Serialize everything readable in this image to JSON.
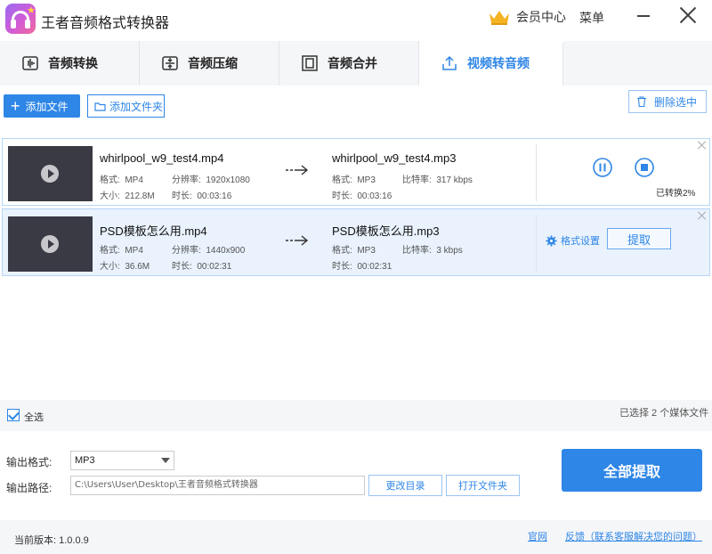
{
  "app": {
    "title": "王者音频格式转换器",
    "vip_label": "会员中心",
    "menu_label": "菜单"
  },
  "tabs": [
    {
      "label": "音频转换",
      "icon": "audio-wave-icon",
      "active": false
    },
    {
      "label": "音频压缩",
      "icon": "compress-icon",
      "active": false
    },
    {
      "label": "音频合并",
      "icon": "merge-icon",
      "active": false
    },
    {
      "label": "视频转音频",
      "icon": "upload-icon",
      "active": true
    }
  ],
  "toolbar": {
    "add_file": "添加文件",
    "add_folder": "添加文件夹",
    "delete_selected": "删除选中"
  },
  "files": [
    {
      "src_name": "whirlpool_w9_test4.mp4",
      "format_key": "格式:",
      "format": "MP4",
      "resolution_key": "分辨率:",
      "resolution": "1920x1080",
      "size_key": "大小:",
      "size": "212.8M",
      "duration_key": "时长:",
      "duration": "00:03:16",
      "dst_name": "whirlpool_w9_test4.mp3",
      "dst_format": "MP3",
      "bitrate_key": "比特率:",
      "bitrate": "317 kbps",
      "dst_duration": "00:03:16",
      "status": "已转换2%",
      "progress": 0.02
    },
    {
      "src_name": "PSD模板怎么用.mp4",
      "format_key": "格式:",
      "format": "MP4",
      "resolution_key": "分辨率:",
      "resolution": "1440x900",
      "size_key": "大小:",
      "size": "36.6M",
      "duration_key": "时长:",
      "duration": "00:02:31",
      "dst_name": "PSD模板怎么用.mp3",
      "dst_format": "MP3",
      "bitrate_key": "比特率:",
      "bitrate": "3 kbps",
      "dst_duration": "00:02:31",
      "format_settings": "格式设置",
      "extract": "提取"
    }
  ],
  "selection": {
    "select_all": "全选",
    "checked": true,
    "count_text": "已选择 2 个媒体文件"
  },
  "output": {
    "format_label": "输出格式:",
    "format_value": "MP3",
    "path_label": "输出路径:",
    "path_value": "C:\\Users\\User\\Desktop\\王者音频格式转换器",
    "change_dir": "更改目录",
    "open_folder": "打开文件夹",
    "extract_all": "全部提取"
  },
  "footer": {
    "version": "当前版本: 1.0.0.9",
    "website": "官网",
    "feedback": "反馈（联系客服解决您的问题）"
  },
  "colors": {
    "accent": "#2e86e6",
    "row_selected_bg": "#e9f2fd",
    "panel_bg": "#f5f6f8"
  }
}
